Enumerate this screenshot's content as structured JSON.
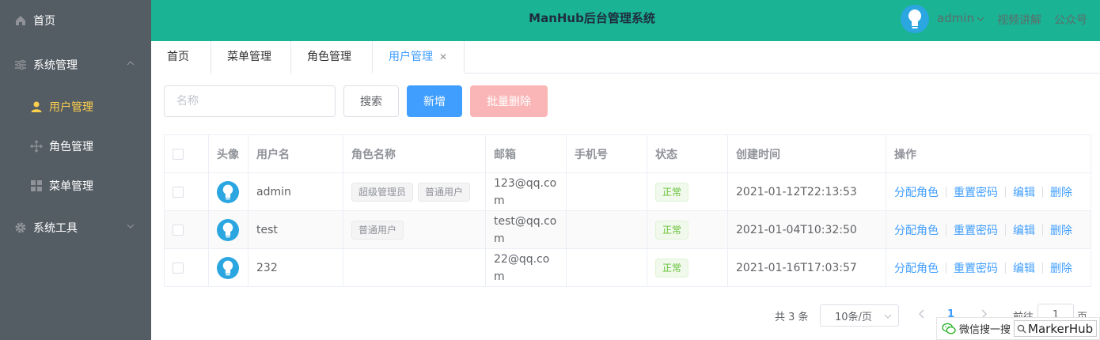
{
  "sidebar": {
    "items": [
      {
        "label": "首页",
        "icon": "home-icon"
      },
      {
        "label": "系统管理",
        "icon": "sliders-icon",
        "expanded": true
      },
      {
        "label": "用户管理",
        "icon": "user-icon",
        "active": true
      },
      {
        "label": "角色管理",
        "icon": "move-icon"
      },
      {
        "label": "菜单管理",
        "icon": "grid-icon"
      },
      {
        "label": "系统工具",
        "icon": "gear-icon",
        "expanded": false
      }
    ],
    "colors": {
      "bg": "#545c64",
      "active": "#ffd04b"
    }
  },
  "header": {
    "title": "ManHub后台管理系统",
    "username": "admin",
    "links": [
      "视频讲解",
      "公众号"
    ],
    "bg": "#1ab394"
  },
  "tabs": [
    {
      "label": "首页"
    },
    {
      "label": "菜单管理"
    },
    {
      "label": "角色管理"
    },
    {
      "label": "用户管理",
      "active": true,
      "closable": true
    }
  ],
  "toolbar": {
    "search_placeholder": "名称",
    "search_value": "",
    "search_label": "搜索",
    "add_label": "新增",
    "batch_delete_label": "批量删除"
  },
  "table": {
    "columns": [
      "头像",
      "用户名",
      "角色名称",
      "邮箱",
      "手机号",
      "状态",
      "创建时间",
      "操作"
    ],
    "rows": [
      {
        "username": "admin",
        "roles": [
          "超级管理员",
          "普通用户"
        ],
        "email": "123@qq.com",
        "phone": "",
        "status": "正常",
        "created": "2021-01-12T22:13:53"
      },
      {
        "username": "test",
        "roles": [
          "普通用户"
        ],
        "email": "test@qq.com",
        "phone": "",
        "status": "正常",
        "created": "2021-01-04T10:32:50"
      },
      {
        "username": "232",
        "roles": [],
        "email": "22@qq.com",
        "phone": "",
        "status": "正常",
        "created": "2021-01-16T17:03:57"
      }
    ],
    "actions": [
      "分配角色",
      "重置密码",
      "编辑",
      "删除"
    ]
  },
  "pagination": {
    "total_text": "共 3 条",
    "page_size": "10条/页",
    "current_page": "1",
    "goto_label": "前往",
    "goto_value": "1",
    "page_suffix": "页"
  },
  "watermark": {
    "label": "微信搜一搜",
    "query": "MarkerHub"
  }
}
